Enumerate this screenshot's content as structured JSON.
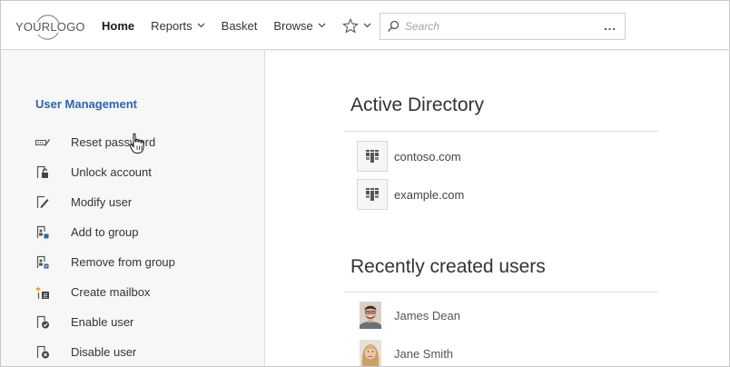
{
  "header": {
    "logo_text": "YOURLOGO",
    "nav": [
      {
        "label": "Home",
        "active": true,
        "has_dropdown": false
      },
      {
        "label": "Reports",
        "active": false,
        "has_dropdown": true
      },
      {
        "label": "Basket",
        "active": false,
        "has_dropdown": false
      },
      {
        "label": "Browse",
        "active": false,
        "has_dropdown": true
      }
    ],
    "favorites_icon": "star-icon",
    "search": {
      "placeholder": "Search",
      "more_label": "..."
    }
  },
  "sidebar": {
    "title": "User Management",
    "items": [
      {
        "label": "Reset password",
        "icon": "reset-password-icon"
      },
      {
        "label": "Unlock account",
        "icon": "unlock-account-icon"
      },
      {
        "label": "Modify user",
        "icon": "modify-user-icon"
      },
      {
        "label": "Add to group",
        "icon": "add-to-group-icon"
      },
      {
        "label": "Remove from group",
        "icon": "remove-from-group-icon"
      },
      {
        "label": "Create mailbox",
        "icon": "create-mailbox-icon"
      },
      {
        "label": "Enable user",
        "icon": "enable-user-icon"
      },
      {
        "label": "Disable user",
        "icon": "disable-user-icon"
      }
    ]
  },
  "main": {
    "active_directory": {
      "title": "Active Directory",
      "domains": [
        {
          "label": "contoso.com",
          "icon": "domain-icon"
        },
        {
          "label": "example.com",
          "icon": "domain-icon"
        }
      ]
    },
    "recent_users": {
      "title": "Recently created users",
      "users": [
        {
          "name": "James Dean",
          "avatar": "avatar-man"
        },
        {
          "name": "Jane Smith",
          "avatar": "avatar-woman"
        }
      ]
    }
  },
  "colors": {
    "accent": "#2e64a8",
    "sidebar_bg": "#f7f7f7",
    "border": "#dcdcdc"
  }
}
